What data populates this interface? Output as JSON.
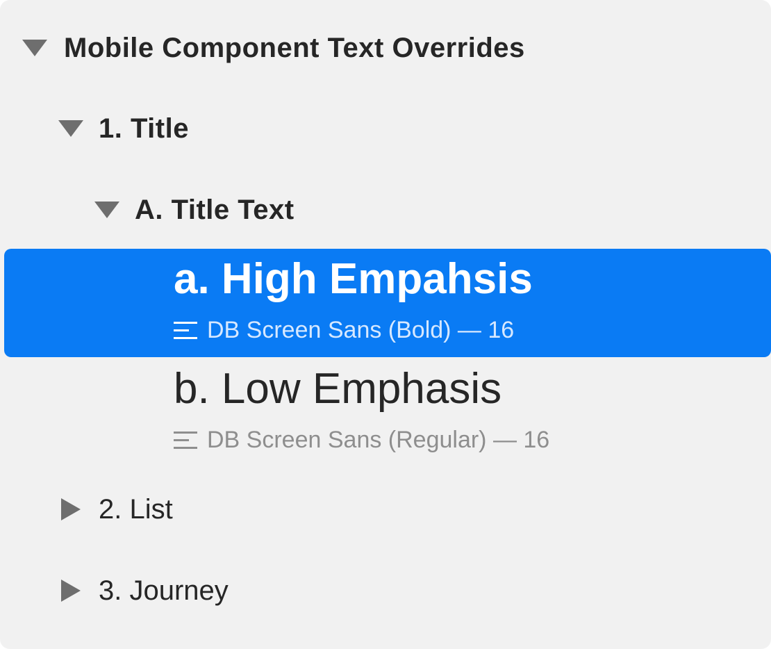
{
  "tree": {
    "root": {
      "label": "Mobile Component Text Overrides",
      "expanded": true,
      "icon": "disclosure-triangle-down-icon"
    },
    "group_title": {
      "label": "1. Title",
      "expanded": true,
      "icon": "disclosure-triangle-down-icon"
    },
    "subgroup_title_text": {
      "label": "A. Title Text",
      "expanded": true,
      "icon": "disclosure-triangle-down-icon"
    },
    "styles": [
      {
        "name": "a. High Empahsis",
        "meta": "DB Screen Sans (Bold) — 16",
        "selected": true,
        "icon": "text-style-icon"
      },
      {
        "name": "b. Low Emphasis",
        "meta": "DB Screen Sans (Regular) — 16",
        "selected": false,
        "icon": "text-style-icon"
      }
    ],
    "group_list": {
      "label": "2. List",
      "expanded": false,
      "icon": "disclosure-triangle-right-icon"
    },
    "group_journey": {
      "label": "3. Journey",
      "expanded": false,
      "icon": "disclosure-triangle-right-icon"
    }
  },
  "colors": {
    "panel_bg": "#f1f1f1",
    "selection": "#0a7bf4",
    "disclosure": "#6e6e6e",
    "secondary_text": "#8e8e8e"
  }
}
